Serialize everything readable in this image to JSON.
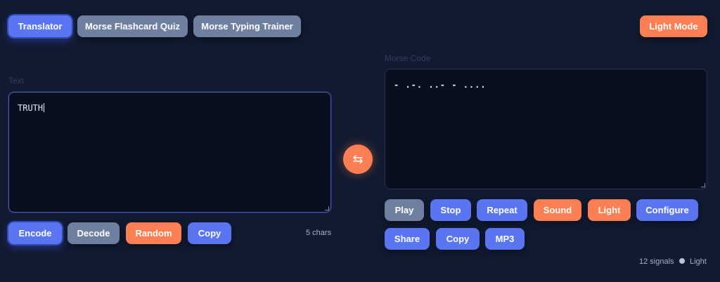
{
  "nav": {
    "translator": "Translator",
    "flashcard_quiz": "Morse Flashcard Quiz",
    "typing_trainer": "Morse Typing Trainer",
    "theme_toggle": "Light Mode"
  },
  "text_panel": {
    "label": "Text",
    "value": "TRUTH",
    "char_count": "5 chars",
    "buttons": {
      "encode": "Encode",
      "decode": "Decode",
      "random": "Random",
      "copy": "Copy"
    }
  },
  "swap": {
    "icon": "swap-arrows-icon",
    "glyph": "⇆"
  },
  "morse_panel": {
    "label": "Morse Code",
    "value": "- .-. ..- - ....",
    "signal_count": "12 signals",
    "mode_label": "Light",
    "buttons": {
      "play": "Play",
      "stop": "Stop",
      "repeat": "Repeat",
      "sound": "Sound",
      "light": "Light",
      "configure": "Configure",
      "share": "Share",
      "copy": "Copy",
      "mp3": "MP3"
    }
  },
  "colors": {
    "background": "#111a30",
    "accent_blue": "#5a75f2",
    "accent_orange": "#fb7f52",
    "muted_gray": "#6f7fa0"
  }
}
